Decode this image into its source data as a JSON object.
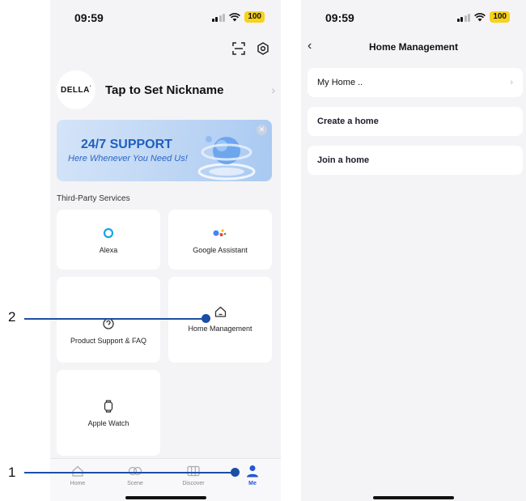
{
  "status": {
    "time": "09:59",
    "battery": "100"
  },
  "left": {
    "nickname": "Tap to Set Nickname",
    "logo_text": "DELLA",
    "banner": {
      "title": "24/7 SUPPORT",
      "subtitle": "Here Whenever You Need Us!"
    },
    "section_label": "Third-Party Services",
    "services": [
      {
        "label": "Alexa",
        "icon": "alexa-icon"
      },
      {
        "label": "Google Assistant",
        "icon": "google-assistant-icon"
      },
      {
        "label": "Product Support & FAQ",
        "icon": "help-icon"
      },
      {
        "label": "Home Management",
        "icon": "house-icon"
      },
      {
        "label": "Apple Watch",
        "icon": "watch-icon"
      }
    ],
    "tabs": [
      {
        "label": "Home",
        "icon": "home-tab-icon"
      },
      {
        "label": "Scene",
        "icon": "scene-tab-icon"
      },
      {
        "label": "Discover",
        "icon": "discover-tab-icon"
      },
      {
        "label": "Me",
        "icon": "person-icon",
        "active": true
      }
    ]
  },
  "right": {
    "title": "Home Management",
    "rows": [
      {
        "label": "My Home ..",
        "chevron": true
      },
      {
        "label": "Create a home"
      },
      {
        "label": "Join a home"
      }
    ]
  },
  "callouts": {
    "one": "1",
    "two": "2"
  },
  "colors": {
    "accent": "#2156d6",
    "callout": "#1b4fa6",
    "battery": "#f7d21b",
    "banner_text": "#1f5fbf"
  }
}
